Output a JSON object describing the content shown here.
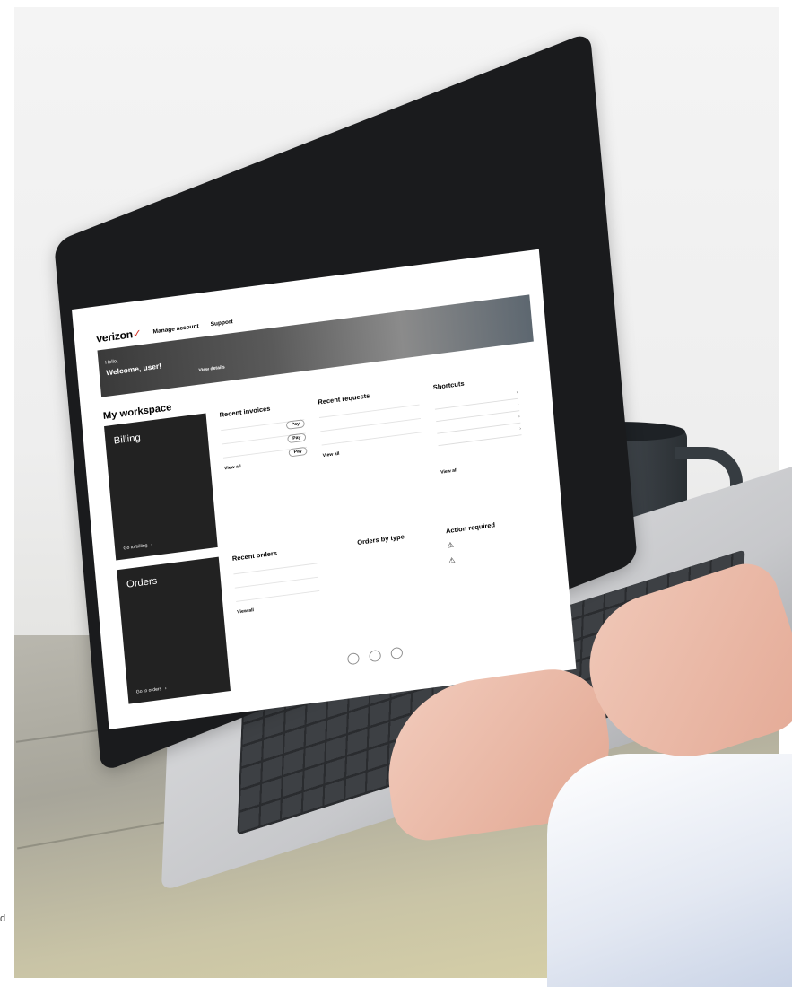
{
  "topbar": {
    "items": [
      "",
      "",
      ""
    ]
  },
  "brand": {
    "logo_text": "verizon",
    "logo_tick": "✓"
  },
  "nav": {
    "links": [
      "Manage account",
      "Support"
    ]
  },
  "hero": {
    "greeting": "Hello,",
    "name": "Welcome, user!",
    "info": "",
    "link": "View details"
  },
  "workspace": {
    "title": "My workspace"
  },
  "tiles": {
    "billing": {
      "title": "Billing",
      "description": "",
      "link": "Go to billing",
      "arrow": "›"
    },
    "orders": {
      "title": "Orders",
      "description": "",
      "link": "Go to orders",
      "arrow": "›"
    }
  },
  "invoices": {
    "heading": "Recent invoices",
    "rows": [
      {
        "label": "",
        "value": "",
        "sub": "",
        "action": "Pay"
      },
      {
        "label": "",
        "value": "",
        "sub": "",
        "action": "Pay"
      },
      {
        "label": "",
        "value": "",
        "sub": "",
        "action": "Pay"
      }
    ],
    "view_all": "View all"
  },
  "requests": {
    "heading": "Recent requests",
    "rows": [
      {
        "label": "",
        "value": "",
        "status": ""
      },
      {
        "label": "",
        "value": "",
        "status": ""
      },
      {
        "label": "",
        "value": "",
        "status": ""
      }
    ],
    "view_all": "View all"
  },
  "shortcuts": {
    "heading": "Shortcuts",
    "items": [
      "",
      "",
      "",
      ""
    ],
    "chevron": "›",
    "view_all": "View all"
  },
  "orders": {
    "heading": "Recent orders",
    "rows": [
      {
        "label": "",
        "value": "",
        "status": ""
      },
      {
        "label": "",
        "value": "",
        "status": ""
      },
      {
        "label": "",
        "value": "",
        "status": ""
      }
    ],
    "view_all": "View all"
  },
  "order_type": {
    "heading": "Orders by type",
    "buttons": [
      "",
      "",
      ""
    ]
  },
  "action": {
    "heading": "Action required",
    "items": [
      {
        "icon": "⚠",
        "count": ""
      },
      {
        "icon": "⚠",
        "count": ""
      }
    ]
  },
  "caption": {
    "text": "d"
  }
}
